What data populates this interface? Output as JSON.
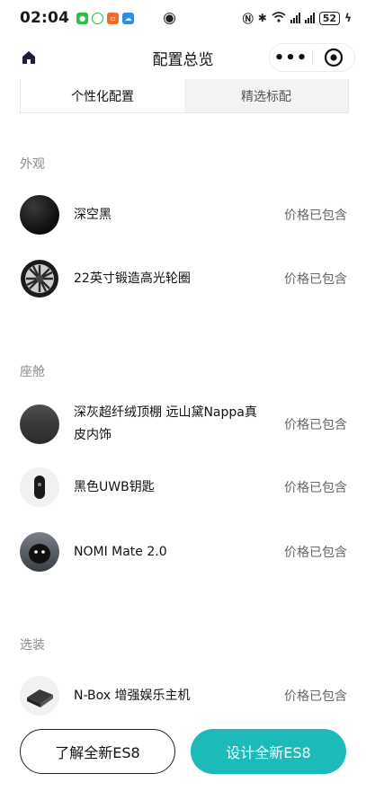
{
  "status_bar": {
    "time": "02:04",
    "battery": "52",
    "icons": [
      "wechat-icon",
      "chat-icon",
      "app-orange-icon",
      "app-blue-icon",
      "eye-icon",
      "nfc-icon",
      "bluetooth-icon",
      "wifi-icon",
      "signal-icon"
    ]
  },
  "nav": {
    "title": "配置总览",
    "more_label": "•••"
  },
  "tabs": [
    {
      "label": "个性化配置",
      "active": true
    },
    {
      "label": "精选标配",
      "active": false
    }
  ],
  "sections": {
    "exterior": {
      "title": "外观",
      "items": [
        {
          "name": "深空黑",
          "price": "价格已包含",
          "icon": "black-paint-swatch"
        },
        {
          "name": "22英寸锻造高光轮圈",
          "price": "价格已包含",
          "icon": "wheel-rim"
        }
      ]
    },
    "cabin": {
      "title": "座舱",
      "items": [
        {
          "name": "深灰超纤绒顶棚 远山黛Nappa真皮内饰",
          "price": "价格已包含",
          "icon": "interior-swatch"
        },
        {
          "name": "黑色UWB钥匙",
          "price": "价格已包含",
          "icon": "car-key"
        },
        {
          "name": "NOMI Mate 2.0",
          "price": "价格已包含",
          "icon": "nomi-robot"
        }
      ]
    },
    "options": {
      "title": "选装",
      "items": [
        {
          "name": "N-Box 增强娱乐主机",
          "price": "价格已包含",
          "icon": "n-box-device"
        }
      ]
    }
  },
  "buttons": {
    "learn": "了解全新ES8",
    "design": "设计全新ES8"
  },
  "colors": {
    "accent": "#1cbab8",
    "section_title": "#8b8b8b",
    "price_text": "#666666"
  }
}
